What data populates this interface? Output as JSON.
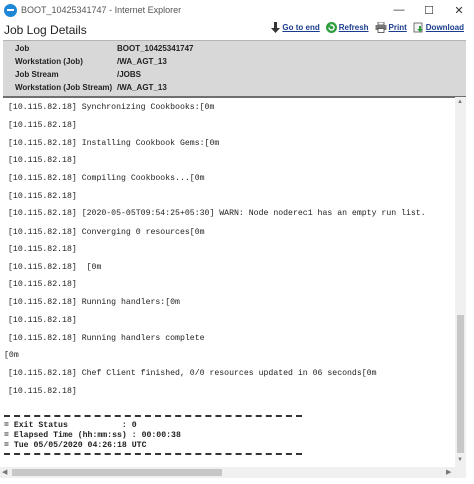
{
  "window": {
    "title": "BOOT_10425341747 - Internet Explorer",
    "minimize": "—",
    "maximize": "☐",
    "close": "✕"
  },
  "header": {
    "title": "Job Log Details",
    "actions": {
      "goto_end": "Go to end",
      "refresh": "Refresh",
      "print": "Print",
      "download": "Download"
    }
  },
  "info": [
    {
      "label": "Job",
      "value": "BOOT_10425341747"
    },
    {
      "label": "Workstation (Job)",
      "value": "/WA_AGT_13"
    },
    {
      "label": "Job Stream",
      "value": "/JOBS"
    },
    {
      "label": "Workstation (Job Stream)",
      "value": "/WA_AGT_13"
    }
  ],
  "log_lines": [
    "[10.115.82.18] Synchronizing Cookbooks:[0m",
    "[10.115.82.18]",
    "[10.115.82.18] Installing Cookbook Gems:[0m",
    "[10.115.82.18]",
    "[10.115.82.18] Compiling Cookbooks...[0m",
    "[10.115.82.18]",
    "[10.115.82.18] [2020-05-05T09:54:25+05:30] WARN: Node noderec1 has an empty run list.",
    "[10.115.82.18] Converging 0 resources[0m",
    "[10.115.82.18]",
    "[10.115.82.18]  [0m",
    "[10.115.82.18]",
    "[10.115.82.18] Running handlers:[0m",
    "[10.115.82.18]",
    "[10.115.82.18] Running handlers complete",
    "[0m",
    "[10.115.82.18] Chef Client finished, 0/0 resources updated in 06 seconds[0m",
    "[10.115.82.18]"
  ],
  "summary": [
    "= Exit Status           : 0",
    "= Elapsed Time (hh:mm:ss) : 00:00:38",
    "= Tue 05/05/2020 04:26:18 UTC"
  ]
}
